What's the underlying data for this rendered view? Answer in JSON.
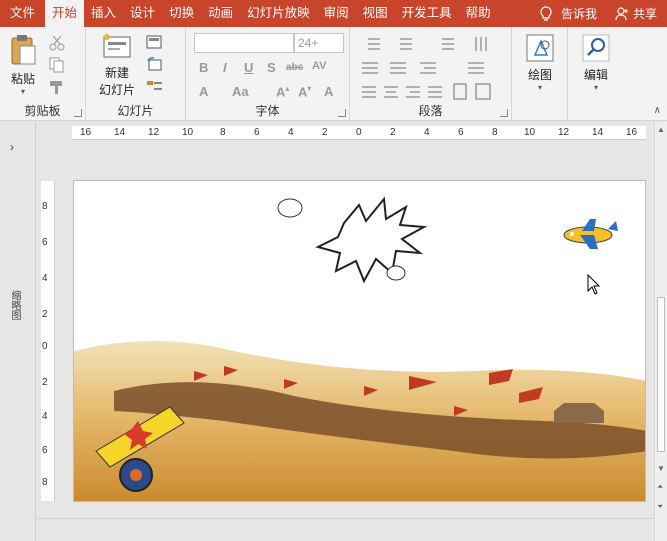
{
  "tabs": [
    "文件",
    "开始",
    "插入",
    "设计",
    "切换",
    "动画",
    "幻灯片放映",
    "审阅",
    "视图",
    "开发工具",
    "帮助"
  ],
  "active_tab": 1,
  "tell_me": "告诉我",
  "share": "共享",
  "groups": {
    "clipboard": {
      "label": "剪贴板",
      "paste": "粘贴"
    },
    "slides": {
      "label": "幻灯片",
      "new_slide_line1": "新建",
      "new_slide_line2": "幻灯片"
    },
    "font": {
      "label": "字体",
      "font_size": "24+"
    },
    "paragraph": {
      "label": "段落"
    },
    "drawing": {
      "label": "绘图"
    },
    "editing": {
      "label": "编辑"
    }
  },
  "thumbnail_pane_label": "缩略图",
  "hruler_labels": [
    "16",
    "14",
    "12",
    "10",
    "8",
    "6",
    "4",
    "2",
    "0",
    "2",
    "4",
    "6",
    "8",
    "10",
    "12",
    "14",
    "16"
  ],
  "vruler_labels": [
    "8",
    "6",
    "4",
    "2",
    "0",
    "2",
    "4",
    "6",
    "8"
  ],
  "colors": {
    "accent": "#c8452b",
    "ribbon": "#f3f3f3"
  }
}
